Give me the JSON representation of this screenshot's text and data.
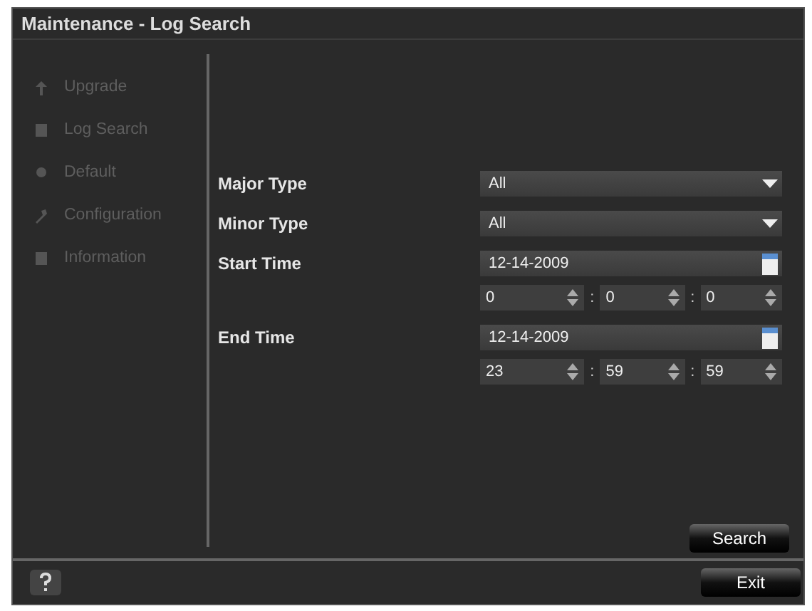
{
  "window": {
    "title": "Maintenance - Log Search"
  },
  "sidebar": {
    "items": [
      {
        "label": "Upgrade",
        "kind": "upgrade"
      },
      {
        "label": "Log Search",
        "kind": "log"
      },
      {
        "label": "Default",
        "kind": "default"
      },
      {
        "label": "Configuration",
        "kind": "config"
      },
      {
        "label": "Information",
        "kind": "info"
      }
    ]
  },
  "form": {
    "fields": [
      {
        "label": "Major Type",
        "kind": "select",
        "value": "All"
      },
      {
        "label": "Minor Type",
        "kind": "select",
        "value": "All"
      },
      {
        "label": "Start Time",
        "kind": "datetime",
        "date": "12-14-2009",
        "time": [
          "0",
          "0",
          "0"
        ],
        "separator": ":"
      },
      {
        "label": "End Time",
        "kind": "datetime",
        "date": "12-14-2009",
        "time": [
          "23",
          "59",
          "59"
        ],
        "separator": ":"
      }
    ]
  },
  "search_button": "Search",
  "exit_button": "Exit"
}
